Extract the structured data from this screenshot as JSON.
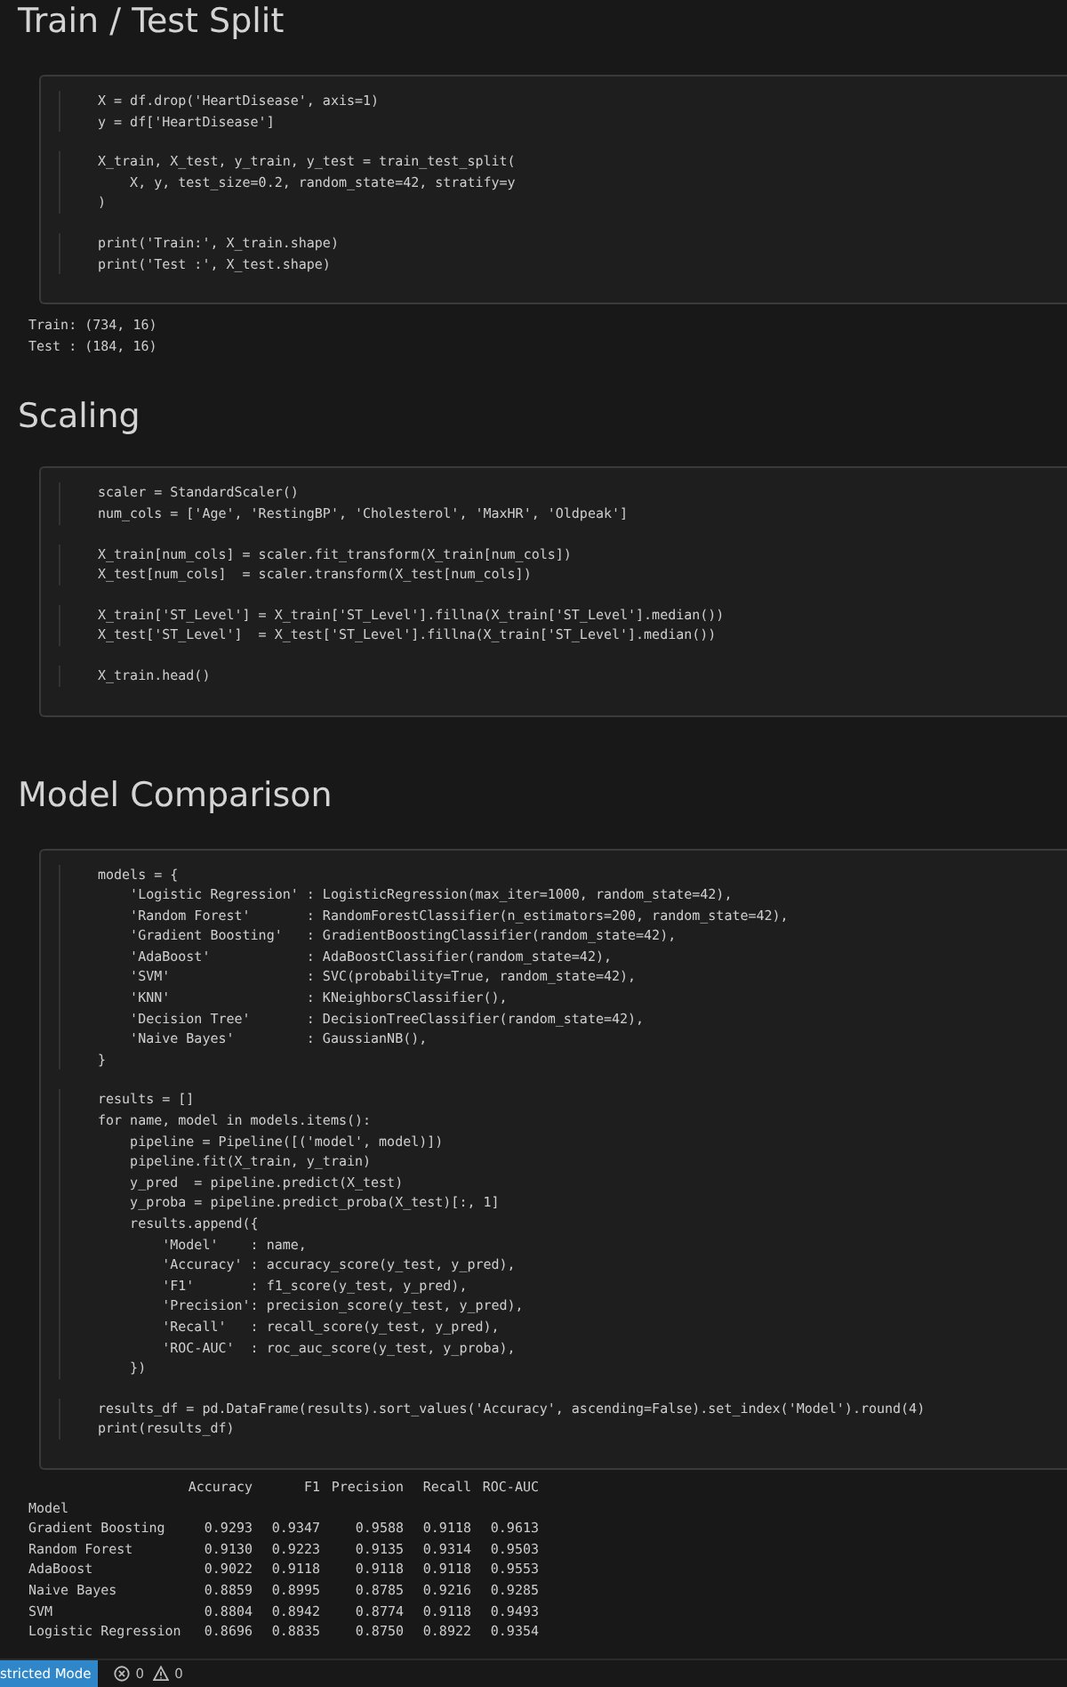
{
  "sections": [
    {
      "title": "Train / Test Split",
      "code_blocks": [
        [
          "X = df.drop('HeartDisease', axis=1)",
          "y = df['HeartDisease']"
        ],
        [
          "X_train, X_test, y_train, y_test = train_test_split(",
          "    X, y, test_size=0.2, random_state=42, stratify=y",
          ")"
        ],
        [
          "print('Train:', X_train.shape)",
          "print('Test :', X_test.shape)"
        ]
      ],
      "output": [
        "Train: (734, 16)",
        "Test : (184, 16)"
      ]
    },
    {
      "title": "Scaling",
      "code_blocks": [
        [
          "scaler = StandardScaler()",
          "num_cols = ['Age', 'RestingBP', 'Cholesterol', 'MaxHR', 'Oldpeak']"
        ],
        [
          "X_train[num_cols] = scaler.fit_transform(X_train[num_cols])",
          "X_test[num_cols]  = scaler.transform(X_test[num_cols])"
        ],
        [
          "X_train['ST_Level'] = X_train['ST_Level'].fillna(X_train['ST_Level'].median())",
          "X_test['ST_Level']  = X_test['ST_Level'].fillna(X_train['ST_Level'].median())"
        ],
        [
          "X_train.head()"
        ]
      ]
    },
    {
      "title": "Model Comparison",
      "code_blocks": [
        [
          "models = {",
          "    'Logistic Regression' : LogisticRegression(max_iter=1000, random_state=42),",
          "    'Random Forest'       : RandomForestClassifier(n_estimators=200, random_state=42),",
          "    'Gradient Boosting'   : GradientBoostingClassifier(random_state=42),",
          "    'AdaBoost'            : AdaBoostClassifier(random_state=42),",
          "    'SVM'                 : SVC(probability=True, random_state=42),",
          "    'KNN'                 : KNeighborsClassifier(),",
          "    'Decision Tree'       : DecisionTreeClassifier(random_state=42),",
          "    'Naive Bayes'         : GaussianNB(),",
          "}"
        ],
        [
          "results = []",
          "for name, model in models.items():",
          "    pipeline = Pipeline([('model', model)])",
          "    pipeline.fit(X_train, y_train)",
          "    y_pred  = pipeline.predict(X_test)",
          "    y_proba = pipeline.predict_proba(X_test)[:, 1]",
          "    results.append({",
          "        'Model'    : name,",
          "        'Accuracy' : accuracy_score(y_test, y_pred),",
          "        'F1'       : f1_score(y_test, y_pred),",
          "        'Precision': precision_score(y_test, y_pred),",
          "        'Recall'   : recall_score(y_test, y_pred),",
          "        'ROC-AUC'  : roc_auc_score(y_test, y_proba),",
          "    })"
        ],
        [
          "results_df = pd.DataFrame(results).sort_values('Accuracy', ascending=False).set_index('Model').round(4)",
          "print(results_df)"
        ]
      ],
      "table": {
        "columns": [
          "Accuracy",
          "F1",
          "Precision",
          "Recall",
          "ROC-AUC"
        ],
        "index_name": "Model",
        "rows": [
          {
            "name": "Gradient Boosting",
            "values": [
              "0.9293",
              "0.9347",
              "0.9588",
              "0.9118",
              "0.9613"
            ]
          },
          {
            "name": "Random Forest",
            "values": [
              "0.9130",
              "0.9223",
              "0.9135",
              "0.9314",
              "0.9503"
            ]
          },
          {
            "name": "AdaBoost",
            "values": [
              "0.9022",
              "0.9118",
              "0.9118",
              "0.9118",
              "0.9553"
            ]
          },
          {
            "name": "Naive Bayes",
            "values": [
              "0.8859",
              "0.8995",
              "0.8785",
              "0.9216",
              "0.9285"
            ]
          },
          {
            "name": "SVM",
            "values": [
              "0.8804",
              "0.8942",
              "0.8774",
              "0.9118",
              "0.9493"
            ]
          },
          {
            "name": "Logistic Regression",
            "values": [
              "0.8696",
              "0.8835",
              "0.8750",
              "0.8922",
              "0.9354"
            ]
          }
        ]
      }
    }
  ],
  "status_bar": {
    "mode": "stricted Mode",
    "errors": "0",
    "warnings": "0"
  }
}
